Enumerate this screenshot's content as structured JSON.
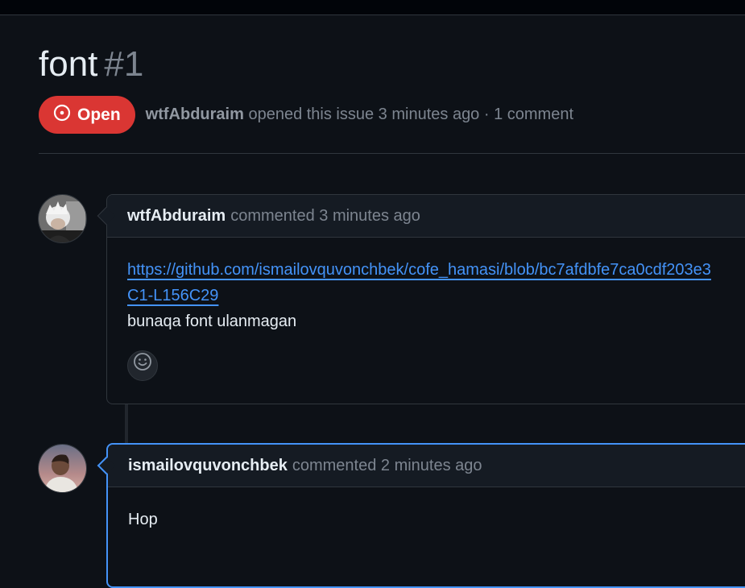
{
  "issue": {
    "title": "font",
    "number": "#1",
    "state": "Open",
    "author": "wtfAbduraim",
    "meta": "opened this issue 3 minutes ago · 1 comment"
  },
  "comments": [
    {
      "author": "wtfAbduraim",
      "action": "commented 3 minutes ago",
      "link_line1": "https://github.com/ismailovquvonchbek/cofe_hamasi/blob/bc7afdbfe7ca0cdf203e3",
      "link_line2": "C1-L156C29",
      "text": "bunaqa font ulanmagan",
      "reaction_icon": "smiley-icon"
    },
    {
      "author": "ismailovquvonchbek",
      "action": "commented 2 minutes ago",
      "text": "Hop"
    }
  ],
  "colors": {
    "background": "#0d1117",
    "open_badge": "#da3633",
    "link": "#4493f8",
    "muted": "#7d8590"
  }
}
